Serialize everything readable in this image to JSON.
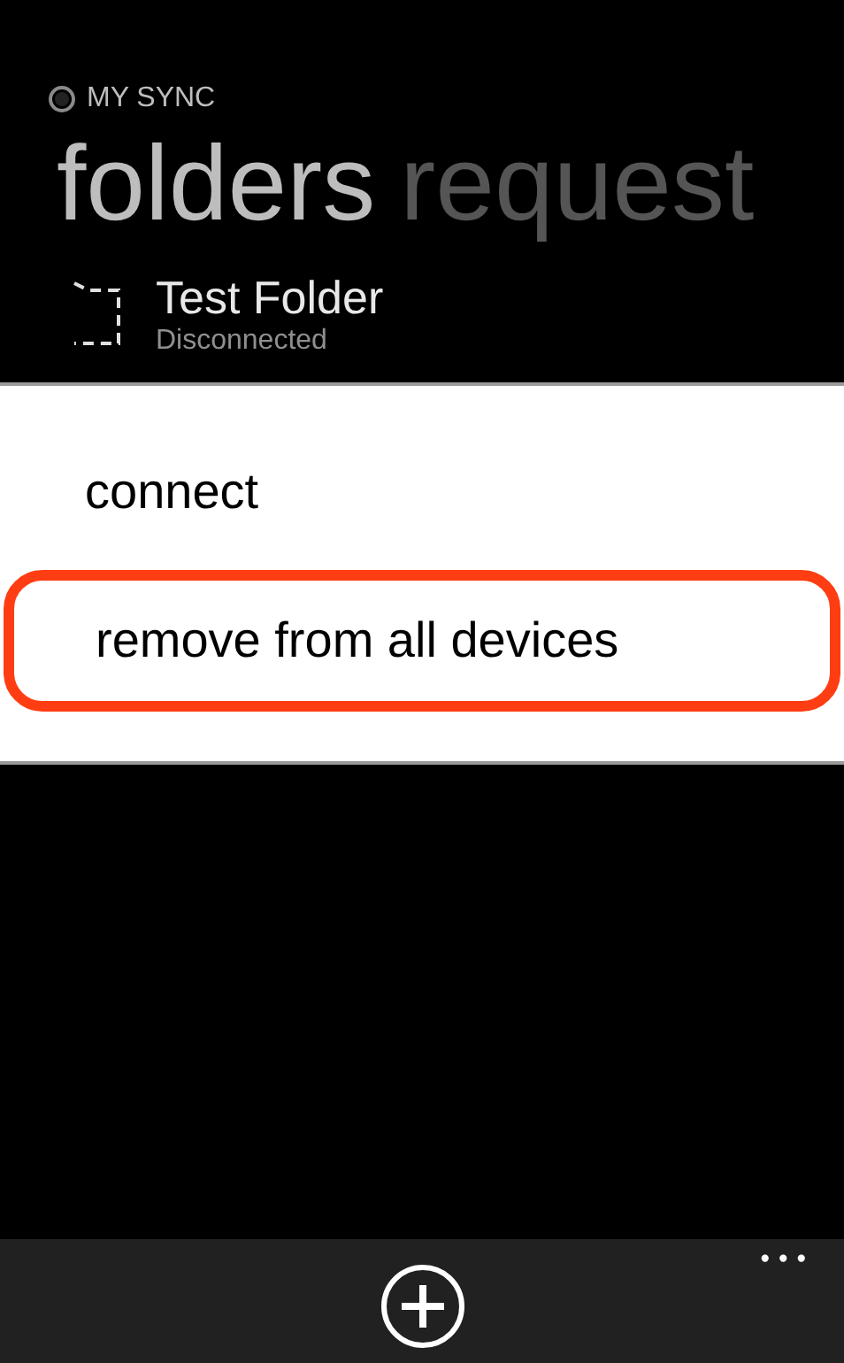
{
  "app_title": "MY SYNC",
  "pivot": [
    {
      "label": "folders",
      "selected": true
    },
    {
      "label": "request",
      "selected": false
    }
  ],
  "folder": {
    "name": "Test Folder",
    "status": "Disconnected"
  },
  "context_menu": [
    {
      "label": "connect",
      "highlighted": false
    },
    {
      "label": "remove from all devices",
      "highlighted": true
    }
  ],
  "app_bar": {
    "more": "•••"
  }
}
